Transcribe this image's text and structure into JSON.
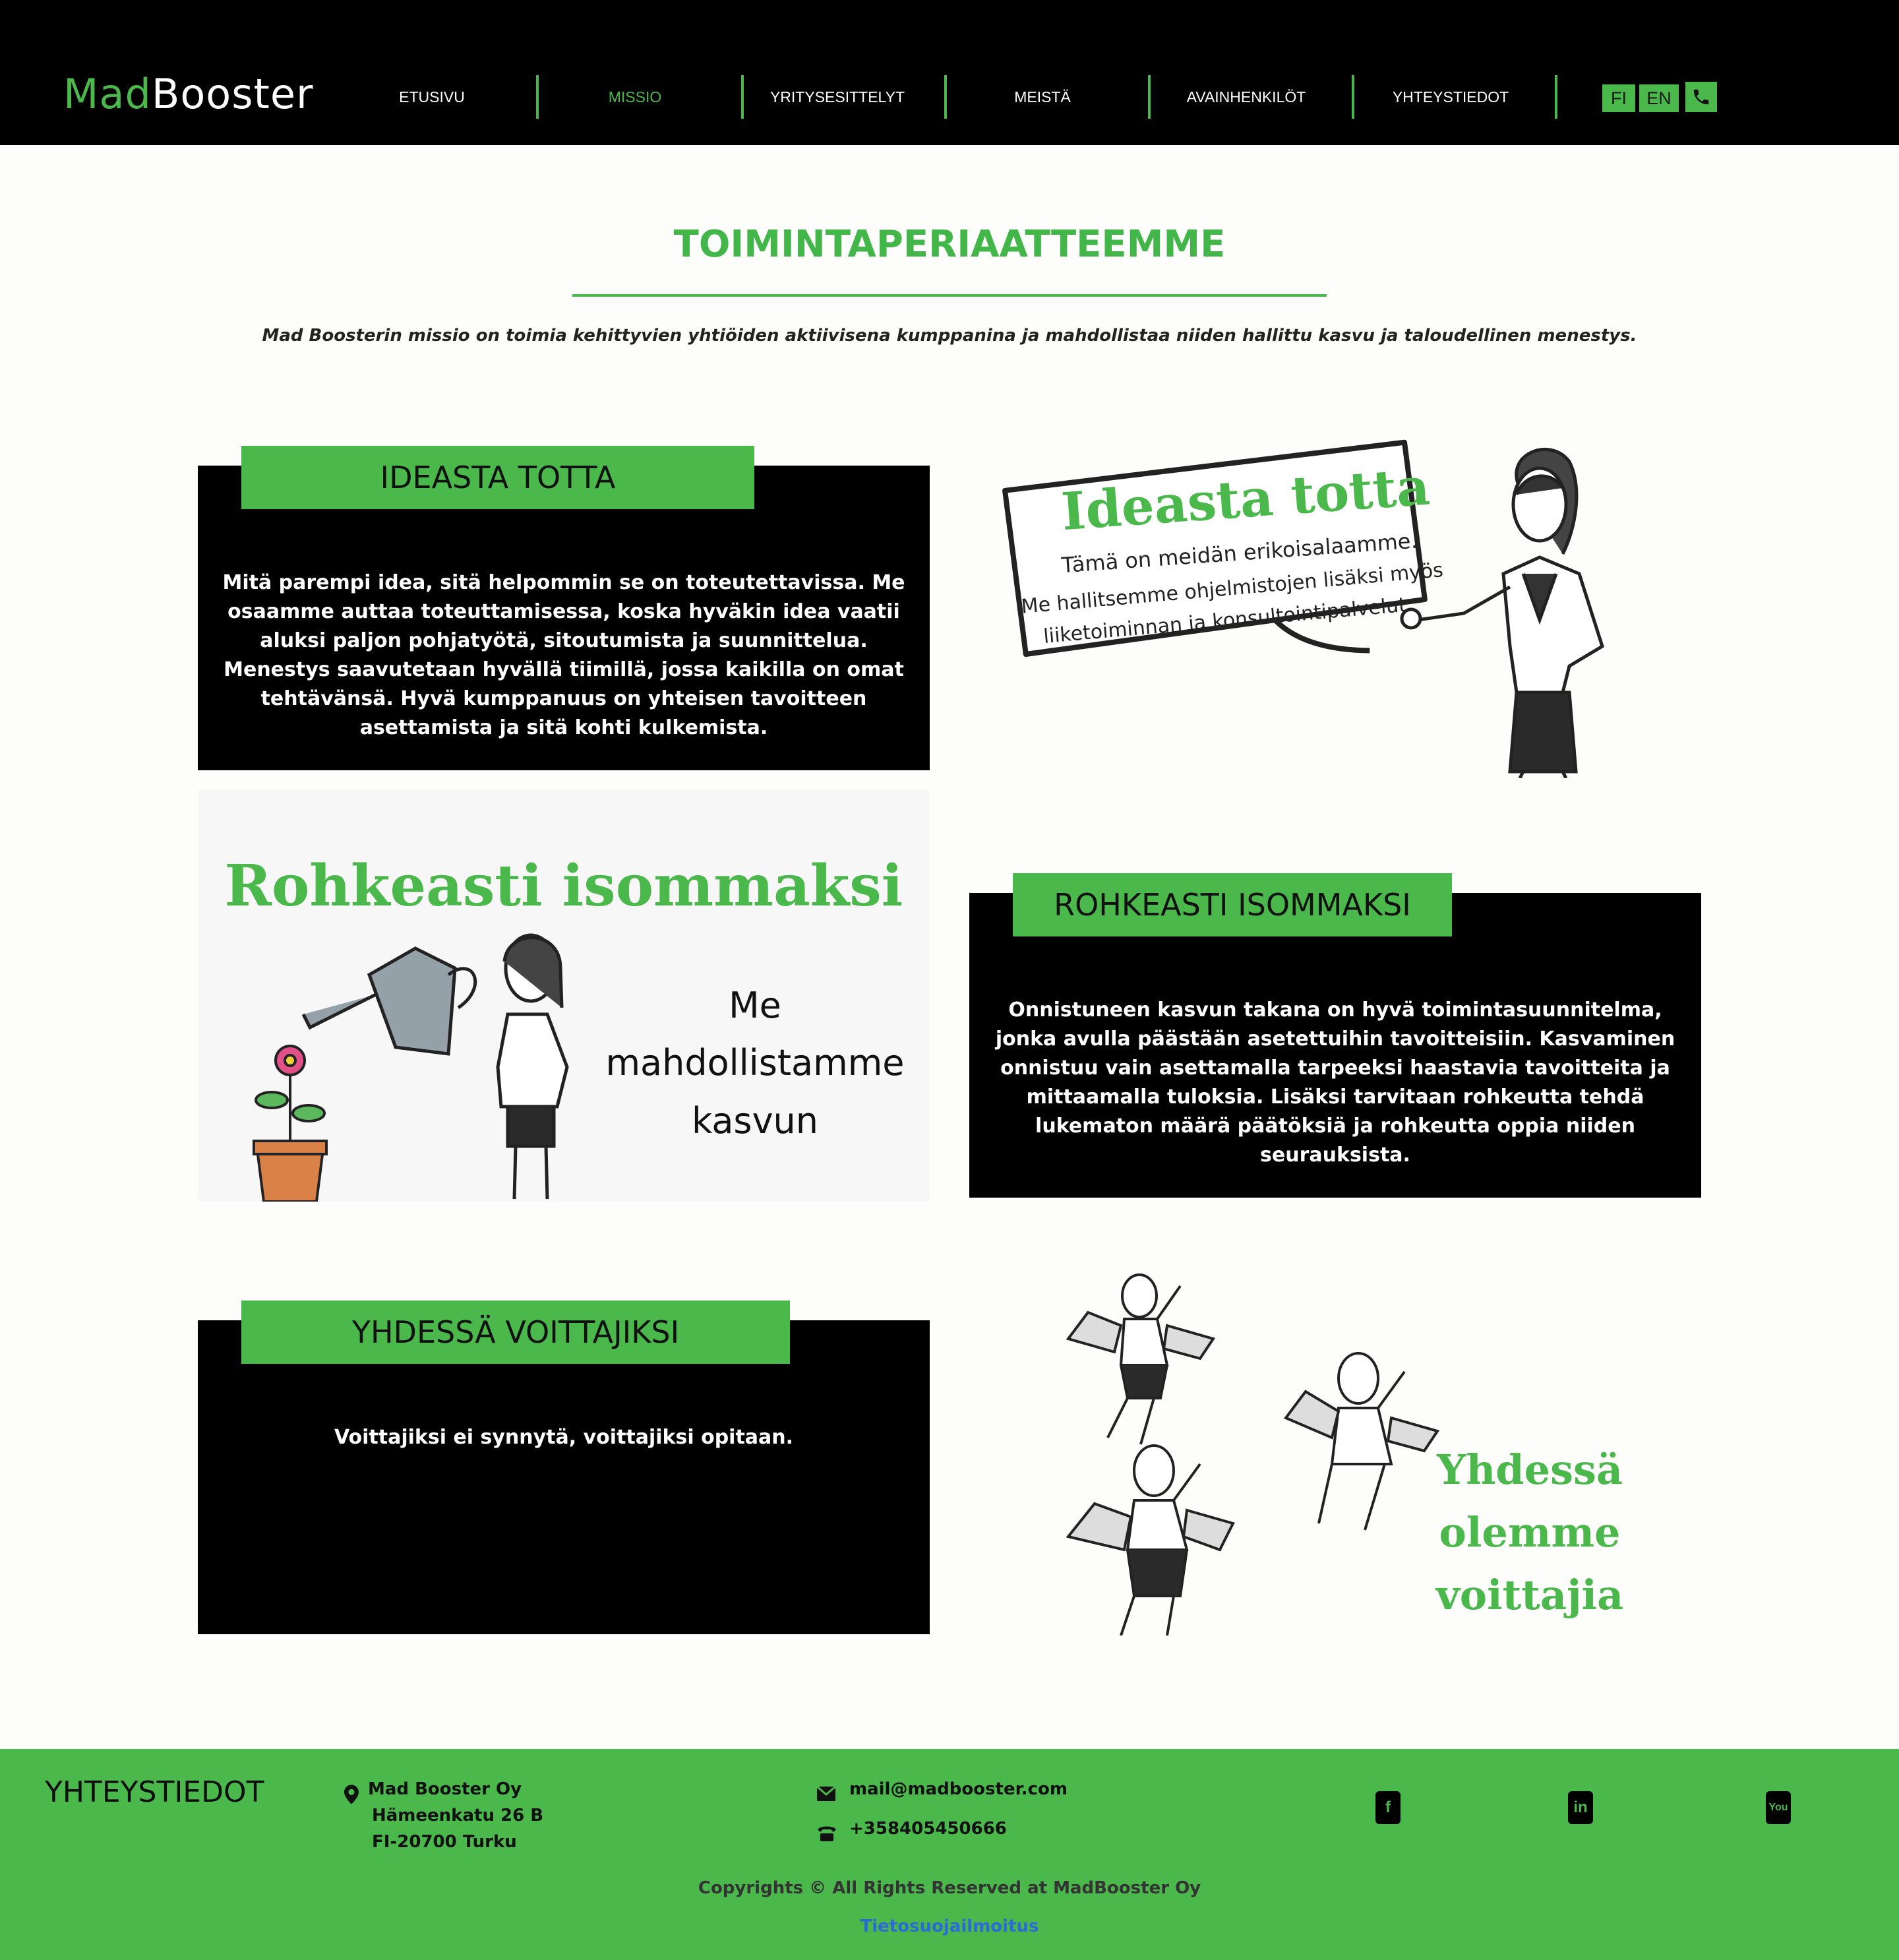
{
  "header": {
    "logo_part1": "Mad",
    "logo_part2": "Booster",
    "nav": [
      {
        "label": "ETUSIVU"
      },
      {
        "label": "MISSIO",
        "active": true
      },
      {
        "label": "YRITYSESITTELYT"
      },
      {
        "label": "MEISTÄ"
      },
      {
        "label": "AVAINHENKILÖT"
      },
      {
        "label": "YHTEYSTIEDOT"
      }
    ],
    "lang_fi": "FI",
    "lang_en": "EN",
    "phone_icon": "phone-icon"
  },
  "hero": {
    "title": "TOIMINTAPERIAATTEEMME",
    "subtitle": "Mad Boosterin missio on toimia kehittyvien yhtiöiden aktiivisena kumppanina ja mahdollistaa niiden hallittu kasvu ja taloudellinen menestys."
  },
  "sections": {
    "ideasta": {
      "heading": "IDEASTA TOTTA",
      "text": "Mitä parempi idea, sitä helpommin se on toteutettavissa. Me osaamme auttaa toteuttamisessa, koska hyväkin idea vaatii aluksi paljon pohjatyötä, sitoutumista ja suunnittelua. Menestys saavutetaan hyvällä tiimillä, jossa kaikilla on omat tehtävänsä. Hyvä kumppanuus on yhteisen tavoitteen asettamista ja sitä kohti kulkemista.",
      "illus_title": "Ideasta totta",
      "illus_line1": "Tämä on meidän erikoisalaamme.",
      "illus_line2": "Me hallitsemme ohjelmistojen lisäksi myös",
      "illus_line3": "liiketoiminnan ja konsultointipalvelut."
    },
    "rohkeasti": {
      "heading": "ROHKEASTI ISOMMAKSI",
      "text": "Onnistuneen kasvun takana on hyvä toimintasuunnitelma, jonka avulla päästään asetettuihin tavoitteisiin. Kasvaminen onnistuu vain asettamalla tarpeeksi haastavia tavoitteita ja mittaamalla tuloksia. Lisäksi tarvitaan rohkeutta tehdä lukematon määrä päätöksiä ja rohkeutta oppia niiden seurauksista.",
      "illus_title": "Rohkeasti isommaksi",
      "illus_line1": "Me",
      "illus_line2": "mahdollistamme",
      "illus_line3": "kasvun"
    },
    "yhdessa": {
      "heading": "YHDESSÄ VOITTAJIKSI",
      "text": "Voittajiksi ei synnytä, voittajiksi opitaan.",
      "illus_line1": "Yhdessä",
      "illus_line2": "olemme",
      "illus_line3": "voittajia"
    }
  },
  "footer": {
    "title": "YHTEYSTIEDOT",
    "company": "Mad Booster Oy",
    "street": "Hämeenkatu 26 B",
    "city": "FI-20700 Turku",
    "email": "mail@madbooster.com",
    "phone": "+358405450666",
    "social": [
      "facebook-icon",
      "linkedin-icon",
      "youtube-icon"
    ],
    "copyright": "Copyrights © All Rights Reserved at MadBooster Oy",
    "privacy": "Tietosuojailmoitus"
  },
  "colors": {
    "accent": "#4ab84a",
    "header_bg": "#000000",
    "card_bg": "#000000",
    "link": "#2a6bd6"
  }
}
